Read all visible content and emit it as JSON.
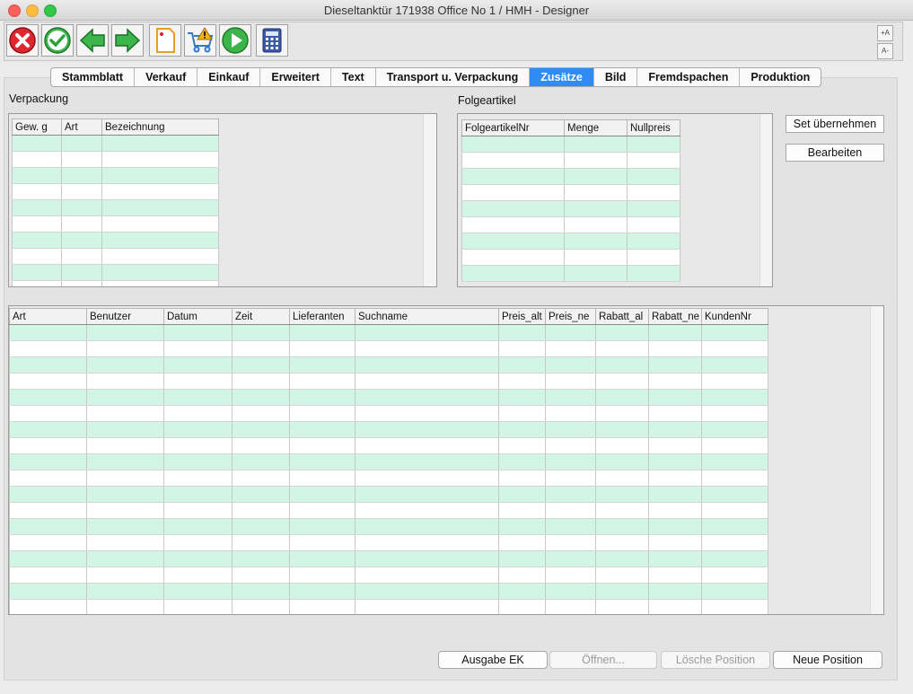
{
  "window": {
    "title": "Dieseltanktür  171938 Office No 1 /  HMH - Designer"
  },
  "toolbar": {
    "buttons": [
      {
        "icon": "cancel-icon"
      },
      {
        "icon": "ok-check-icon"
      },
      {
        "icon": "arrow-left-icon"
      },
      {
        "icon": "arrow-right-icon"
      },
      {
        "icon": "document-icon"
      },
      {
        "icon": "cart-warning-icon"
      },
      {
        "icon": "play-icon"
      },
      {
        "icon": "calculator-icon"
      }
    ],
    "font_increase": "+A",
    "font_decrease": "A-"
  },
  "tabs": [
    {
      "label": "Stammblatt"
    },
    {
      "label": "Verkauf"
    },
    {
      "label": "Einkauf"
    },
    {
      "label": "Erweitert"
    },
    {
      "label": "Text"
    },
    {
      "label": "Transport u. Verpackung"
    },
    {
      "label": "Zusätze",
      "active": true
    },
    {
      "label": "Bild"
    },
    {
      "label": "Fremdspachen"
    },
    {
      "label": "Produktion"
    }
  ],
  "verpackung": {
    "title": "Verpackung",
    "columns": [
      "Gew. g",
      "Art",
      "Bezeichnung"
    ]
  },
  "folgeartikel": {
    "title": "Folgeartikel",
    "columns": [
      "FolgeartikelNr",
      "Menge",
      "Nullpreis"
    ]
  },
  "side_buttons": {
    "set_uebernehmen": "Set übernehmen",
    "bearbeiten": "Bearbeiten"
  },
  "history": {
    "columns": [
      "Art",
      "Benutzer",
      "Datum",
      "Zeit",
      "Lieferanten",
      "Suchname",
      "Preis_alt",
      "Preis_ne",
      "Rabatt_al",
      "Rabatt_ne",
      "KundenNr"
    ]
  },
  "bottom_buttons": {
    "ausgabe_ek": "Ausgabe EK",
    "oeffnen": "Öffnen...",
    "loesche_position": "Lösche Position",
    "neue_position": "Neue Position"
  },
  "colors": {
    "accent": "#2f8bf5",
    "row_alt": "#d2f6e6"
  }
}
